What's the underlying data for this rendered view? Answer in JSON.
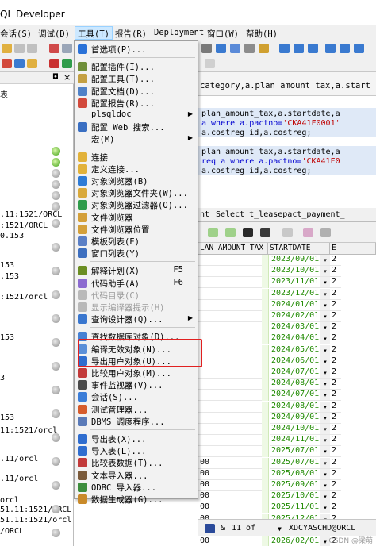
{
  "window": {
    "title": "QL Developer"
  },
  "menubar": {
    "items": [
      "会话(S)",
      "调试(D)",
      "工具(T)",
      "报告(R)",
      "Deployment",
      "窗口(W)",
      "帮助(H)"
    ]
  },
  "left_panel": {
    "header_glyphs": [
      "◘",
      "×"
    ],
    "top_label": "表",
    "lines": [
      ".11:1521/ORCL",
      ":1521/ORCL",
      "0.153",
      "153",
      ".153",
      ":1521/orcl",
      "153",
      "3",
      "153",
      "11:1521/orcl",
      ".11/orcl",
      ".11/orcl",
      "orcl",
      "51.11:1521/ORCL",
      "51.11:1521/orcl",
      "/ORCL"
    ]
  },
  "sql_tab": {
    "title": "category,a.plan_amount_tax,a.start"
  },
  "sql_editor": {
    "lines": [
      [
        "plan_amount_tax,a.startdate,a"
      ],
      [
        "a where a.pactno=",
        "'CKA41F0001'"
      ],
      [
        "a.costreg_id,a.costreg;"
      ],
      [
        "plan_amount_tax,a.startdate,a"
      ],
      [
        "req a where a.pactno=",
        "'CKA41F0"
      ],
      [
        "a.costreg_id,a.costreg;"
      ]
    ]
  },
  "result_tabs": [
    "nt",
    "Select t_leasepact_payment_"
  ],
  "grid": {
    "headers": [
      "LAN_AMOUNT_TAX",
      "STARTDATE",
      "E"
    ],
    "left_values": [
      "",
      "",
      "",
      "",
      "",
      "",
      "",
      "",
      "",
      "",
      "",
      "",
      "",
      "",
      "",
      "",
      "",
      "",
      "00",
      "00",
      "00",
      "00",
      "00",
      "00",
      "00",
      "00"
    ],
    "dates": [
      "2023/09/01",
      "2023/10/01",
      "2023/11/01",
      "2023/12/01",
      "2024/01/01",
      "2024/02/01",
      "2024/03/01",
      "2024/04/01",
      "2024/05/01",
      "2024/06/01",
      "2024/07/01",
      "2024/08/01",
      "2024/07/01",
      "2024/08/01",
      "2024/09/01",
      "2024/10/01",
      "2024/11/01",
      "2025/07/01",
      "2025/07/01",
      "2025/08/01",
      "2025/09/01",
      "2025/10/01",
      "2025/11/01",
      "2025/12/01",
      "2026/01/01",
      "2026/02/01"
    ],
    "drop_glyph": "▾",
    "e_value": "2"
  },
  "statusbar": {
    "record": "11 of",
    "connection": "XDCYASCHD@ORCL",
    "amp": "&"
  },
  "watermark": "CSDN @梁萌",
  "tools_menu": {
    "items": [
      {
        "label": "首选项(P)...",
        "shortcut": "",
        "arrow": false,
        "disabled": false,
        "icon": "check-icon",
        "color": "#2b72d8"
      },
      {
        "sep": true
      },
      {
        "label": "配置插件(I)...",
        "shortcut": "",
        "arrow": false,
        "disabled": false,
        "icon": "plugin-icon",
        "color": "#6f8f3a"
      },
      {
        "label": "配置工具(T)...",
        "shortcut": "",
        "arrow": false,
        "disabled": false,
        "icon": "tools-icon",
        "color": "#c4a042"
      },
      {
        "label": "配置文档(D)...",
        "shortcut": "",
        "arrow": false,
        "disabled": false,
        "icon": "doc-icon",
        "color": "#5082c8"
      },
      {
        "label": "配置报告(R)...",
        "shortcut": "",
        "arrow": false,
        "disabled": false,
        "icon": "report-icon",
        "color": "#d24a3c"
      },
      {
        "label": "plsqldoc",
        "shortcut": "",
        "arrow": true,
        "disabled": false,
        "icon": "",
        "color": ""
      },
      {
        "label": "配置 Web 搜索...",
        "shortcut": "",
        "arrow": false,
        "disabled": false,
        "icon": "web-search-icon",
        "color": "#3a6fc2"
      },
      {
        "label": "宏(M)",
        "shortcut": "",
        "arrow": true,
        "disabled": false,
        "icon": "",
        "color": ""
      },
      {
        "sep": true
      },
      {
        "label": "连接",
        "shortcut": "",
        "arrow": false,
        "disabled": false,
        "icon": "connect-icon",
        "color": "#e2b23a"
      },
      {
        "label": "定义连接...",
        "shortcut": "",
        "arrow": false,
        "disabled": false,
        "icon": "define-connection-icon",
        "color": "#e2b23a"
      },
      {
        "label": "对象浏览器(B)",
        "shortcut": "",
        "arrow": false,
        "disabled": false,
        "icon": "object-browser-icon",
        "color": "#2e7bd6"
      },
      {
        "label": "对象浏览器文件夹(W)...",
        "shortcut": "",
        "arrow": false,
        "disabled": false,
        "icon": "folder-icon",
        "color": "#d9a93b"
      },
      {
        "label": "对象浏览器过滤器(O)...",
        "shortcut": "",
        "arrow": false,
        "disabled": false,
        "icon": "filter-icon",
        "color": "#2f9c4b"
      },
      {
        "label": "文件浏览器",
        "shortcut": "",
        "arrow": false,
        "disabled": false,
        "icon": "file-browser-icon",
        "color": "#d4a03a"
      },
      {
        "label": "文件浏览器位置",
        "shortcut": "",
        "arrow": false,
        "disabled": false,
        "icon": "file-location-icon",
        "color": "#d4a03a"
      },
      {
        "label": "模板列表(E)",
        "shortcut": "",
        "arrow": false,
        "disabled": false,
        "icon": "template-icon",
        "color": "#5a7fc6"
      },
      {
        "label": "窗口列表(Y)",
        "shortcut": "",
        "arrow": false,
        "disabled": false,
        "icon": "window-list-icon",
        "color": "#3d6fbf"
      },
      {
        "sep": true
      },
      {
        "label": "解释计划(X)",
        "shortcut": "F5",
        "arrow": false,
        "disabled": false,
        "icon": "explain-plan-icon",
        "color": "#6b8e23"
      },
      {
        "label": "代码助手(A)",
        "shortcut": "F6",
        "arrow": false,
        "disabled": false,
        "icon": "code-assistant-icon",
        "color": "#8c6bd0"
      },
      {
        "label": "代码目录(C)",
        "shortcut": "",
        "arrow": false,
        "disabled": true,
        "icon": "code-contents-icon",
        "color": "#b9b9b9"
      },
      {
        "label": "显示编译器提示(H)",
        "shortcut": "",
        "arrow": false,
        "disabled": true,
        "icon": "compiler-hints-icon",
        "color": "#b9b9b9"
      },
      {
        "label": "查询设计器(Q)...",
        "shortcut": "",
        "arrow": true,
        "disabled": false,
        "icon": "query-designer-icon",
        "color": "#3a77cf"
      },
      {
        "sep": true
      },
      {
        "label": "查找数据库对象(D)...",
        "shortcut": "",
        "arrow": false,
        "disabled": false,
        "icon": "find-db-objects-icon",
        "color": "#4681d4"
      },
      {
        "label": "编译无效对象(N)...",
        "shortcut": "",
        "arrow": false,
        "disabled": false,
        "icon": "compile-invalid-icon",
        "color": "#5b8fd8"
      },
      {
        "label": "导出用户对象(U)...",
        "shortcut": "",
        "arrow": false,
        "disabled": false,
        "icon": "export-user-objects-icon",
        "color": "#2f6dcf"
      },
      {
        "label": "比较用户对象(M)...",
        "shortcut": "",
        "arrow": false,
        "disabled": false,
        "icon": "compare-user-objects-icon",
        "color": "#c23a3a"
      },
      {
        "label": "事件监视器(V)...",
        "shortcut": "",
        "arrow": false,
        "disabled": false,
        "icon": "event-monitor-icon",
        "color": "#4a4a4a"
      },
      {
        "label": "会话(S)...",
        "shortcut": "",
        "arrow": false,
        "disabled": false,
        "icon": "sessions-icon",
        "color": "#3b7dd8"
      },
      {
        "label": "测试管理器...",
        "shortcut": "",
        "arrow": false,
        "disabled": false,
        "icon": "test-manager-icon",
        "color": "#d65c2c"
      },
      {
        "label": "DBMS 调度程序...",
        "shortcut": "",
        "arrow": false,
        "disabled": false,
        "icon": "dbms-scheduler-icon",
        "color": "#5a7ab8"
      },
      {
        "sep": true
      },
      {
        "label": "导出表(X)...",
        "shortcut": "",
        "arrow": false,
        "disabled": false,
        "icon": "export-tables-icon",
        "color": "#2f6dcf"
      },
      {
        "label": "导入表(L)...",
        "shortcut": "",
        "arrow": false,
        "disabled": false,
        "icon": "import-tables-icon",
        "color": "#2f6dcf"
      },
      {
        "label": "比较表数据(T)...",
        "shortcut": "",
        "arrow": false,
        "disabled": false,
        "icon": "compare-table-data-icon",
        "color": "#c23a3a"
      },
      {
        "label": "文本导入器...",
        "shortcut": "",
        "arrow": false,
        "disabled": false,
        "icon": "text-importer-icon",
        "color": "#7a5a3a"
      },
      {
        "label": "ODBC 导入器...",
        "shortcut": "",
        "arrow": false,
        "disabled": false,
        "icon": "odbc-importer-icon",
        "color": "#3d8d3d"
      },
      {
        "label": "数据生成器(G)...",
        "shortcut": "",
        "arrow": false,
        "disabled": false,
        "icon": "data-generator-icon",
        "color": "#c98a2a"
      }
    ]
  }
}
